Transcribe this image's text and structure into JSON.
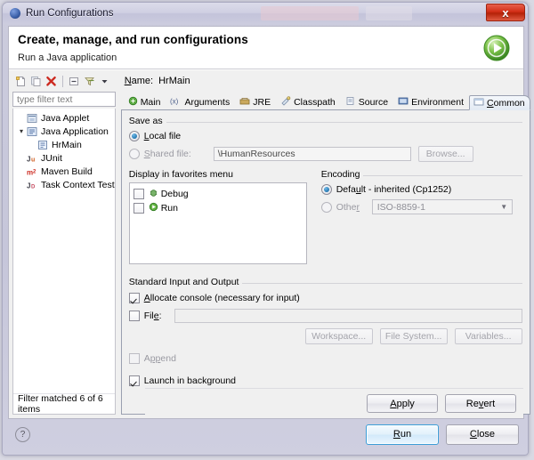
{
  "window": {
    "title": "Run Configurations",
    "title_icon": "run-config-icon",
    "close_label": "x"
  },
  "header": {
    "title": "Create, manage, and run configurations",
    "subtitle": "Run a Java application",
    "icon": "green-run-icon"
  },
  "tree_toolbar": {
    "items": [
      {
        "name": "new-configuration-icon",
        "label": ""
      },
      {
        "name": "duplicate-configuration-icon",
        "label": ""
      },
      {
        "name": "delete-configuration-icon",
        "label": ""
      },
      {
        "name": "collapse-all-icon",
        "label": ""
      },
      {
        "name": "filter-icon",
        "label": ""
      },
      {
        "name": "view-menu-chevron-icon",
        "label": ""
      }
    ]
  },
  "filter": {
    "placeholder": "type filter text",
    "value": "",
    "status": "Filter matched 6 of 6 items"
  },
  "tree": {
    "items": [
      {
        "label": "Java Applet",
        "icon": "java-applet-icon",
        "indent": 1,
        "expander": "",
        "selected": false
      },
      {
        "label": "Java Application",
        "icon": "java-application-icon",
        "indent": 0,
        "expander": "▾",
        "selected": false
      },
      {
        "label": "HrMain",
        "icon": "java-launch-icon",
        "indent": 2,
        "expander": "",
        "selected": false
      },
      {
        "label": "JUnit",
        "icon": "junit-icon",
        "indent": 1,
        "expander": "",
        "selected": false
      },
      {
        "label": "Maven Build",
        "icon": "maven-icon",
        "indent": 1,
        "expander": "",
        "selected": false
      },
      {
        "label": "Task Context Test",
        "icon": "task-context-icon",
        "indent": 1,
        "expander": "",
        "selected": false
      }
    ]
  },
  "name_field": {
    "label": "Name:",
    "label_underline": "N",
    "value": "HrMain"
  },
  "tabs": [
    {
      "label": "Main",
      "icon": "main-tab-icon",
      "selected": false
    },
    {
      "label": "Arguments",
      "icon": "arguments-tab-icon",
      "selected": false
    },
    {
      "label": "JRE",
      "icon": "jre-tab-icon",
      "selected": false
    },
    {
      "label": "Classpath",
      "icon": "classpath-tab-icon",
      "selected": false
    },
    {
      "label": "Source",
      "icon": "source-tab-icon",
      "selected": false
    },
    {
      "label": "Environment",
      "icon": "environment-tab-icon",
      "selected": false
    },
    {
      "label": "Common",
      "icon": "common-tab-icon",
      "selected": true
    }
  ],
  "common_tab": {
    "save_as": {
      "title": "Save as",
      "local_file": {
        "label": "Local file",
        "underline": "L",
        "selected": true
      },
      "shared_file": {
        "label": "Shared file:",
        "underline": "S",
        "selected": false
      },
      "shared_path_value": "\\HumanResources",
      "browse_label": "Browse...",
      "browse_underline": "B",
      "browse_enabled": false
    },
    "favorites": {
      "title": "Display in favorites menu",
      "items": [
        {
          "label": "Debug",
          "icon": "debug-bug-icon",
          "checked": false
        },
        {
          "label": "Run",
          "icon": "run-green-icon",
          "checked": false
        }
      ]
    },
    "encoding": {
      "title": "Encoding",
      "default_option": {
        "label": "Default - inherited (Cp1252)",
        "underline": "u",
        "selected": true
      },
      "other_option": {
        "label": "Other",
        "underline": "r",
        "selected": false
      },
      "other_value": "ISO-8859-1",
      "other_enabled": false
    },
    "std_io": {
      "title": "Standard Input and Output",
      "allocate_console": {
        "label": "Allocate console (necessary for input)",
        "checked": true
      },
      "file": {
        "label": "File:",
        "checked": false,
        "value": ""
      },
      "buttons": [
        {
          "label": "Workspace...",
          "enabled": false
        },
        {
          "label": "File System...",
          "enabled": false
        },
        {
          "label": "Variables...",
          "enabled": false
        }
      ],
      "append": {
        "label": "Append",
        "checked": false,
        "enabled": false
      },
      "launch_in_background": {
        "label": "Launch in background",
        "checked": true
      }
    }
  },
  "action_bar": {
    "apply_label": "Apply",
    "apply_underline": "A",
    "revert_label": "Revert",
    "revert_underline": "v"
  },
  "dialog_bar": {
    "help_label": "?",
    "run_label": "Run",
    "run_underline": "R",
    "close_label": "Close",
    "close_underline": "C"
  },
  "colors": {
    "accent_blue": "#3c9ed8",
    "run_green": "#4aa72e",
    "delete_red": "#cc2a20",
    "titlebar": "#ccccdd",
    "panel_bg": "#f0f0f0"
  }
}
